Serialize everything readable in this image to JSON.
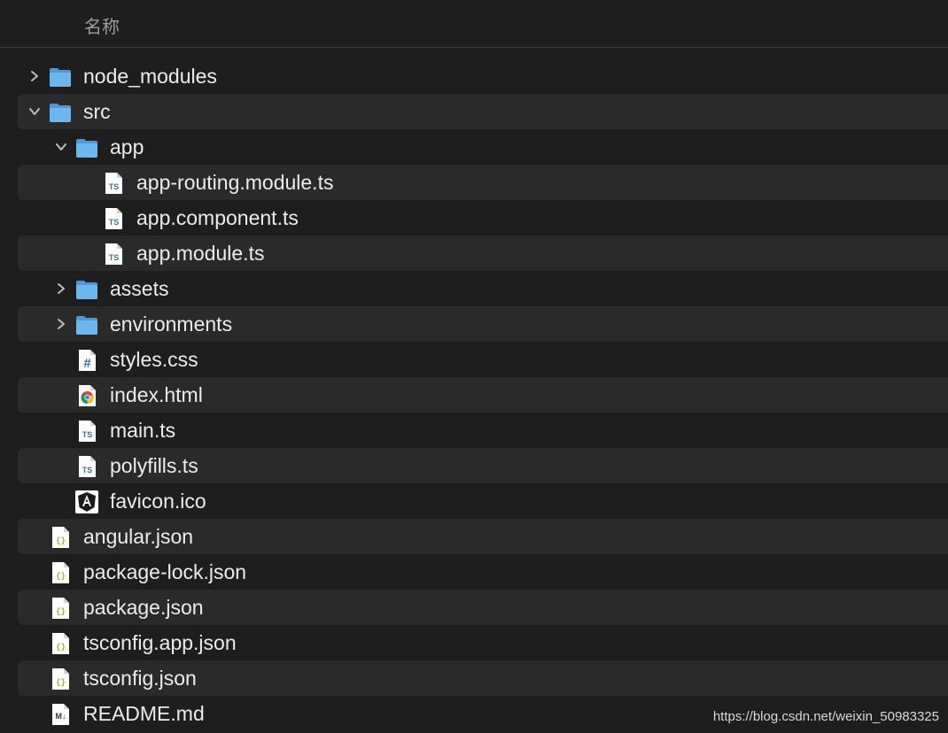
{
  "header": {
    "column_name": "名称"
  },
  "items": [
    {
      "label": "node_modules",
      "kind": "folder",
      "depth": 0,
      "chevron": "right"
    },
    {
      "label": "src",
      "kind": "folder",
      "depth": 0,
      "chevron": "down"
    },
    {
      "label": "app",
      "kind": "folder",
      "depth": 1,
      "chevron": "down"
    },
    {
      "label": "app-routing.module.ts",
      "kind": "ts",
      "depth": 2,
      "chevron": "none"
    },
    {
      "label": "app.component.ts",
      "kind": "ts",
      "depth": 2,
      "chevron": "none"
    },
    {
      "label": "app.module.ts",
      "kind": "ts",
      "depth": 2,
      "chevron": "none"
    },
    {
      "label": "assets",
      "kind": "folder",
      "depth": 1,
      "chevron": "right"
    },
    {
      "label": "environments",
      "kind": "folder",
      "depth": 1,
      "chevron": "right"
    },
    {
      "label": "styles.css",
      "kind": "css",
      "depth": 1,
      "chevron": "none"
    },
    {
      "label": "index.html",
      "kind": "html",
      "depth": 1,
      "chevron": "none"
    },
    {
      "label": "main.ts",
      "kind": "ts",
      "depth": 1,
      "chevron": "none"
    },
    {
      "label": "polyfills.ts",
      "kind": "ts",
      "depth": 1,
      "chevron": "none"
    },
    {
      "label": "favicon.ico",
      "kind": "angular",
      "depth": 1,
      "chevron": "none"
    },
    {
      "label": "angular.json",
      "kind": "json",
      "depth": 0,
      "chevron": "none"
    },
    {
      "label": "package-lock.json",
      "kind": "json",
      "depth": 0,
      "chevron": "none"
    },
    {
      "label": "package.json",
      "kind": "json",
      "depth": 0,
      "chevron": "none"
    },
    {
      "label": "tsconfig.app.json",
      "kind": "json",
      "depth": 0,
      "chevron": "none"
    },
    {
      "label": "tsconfig.json",
      "kind": "json",
      "depth": 0,
      "chevron": "none"
    },
    {
      "label": "README.md",
      "kind": "markdown",
      "depth": 0,
      "chevron": "none"
    }
  ],
  "watermark": "https://blog.csdn.net/weixin_50983325",
  "colors": {
    "folder": "#5aabe8",
    "alt_row": "#2a2a2a",
    "background": "#1e1e1e"
  }
}
